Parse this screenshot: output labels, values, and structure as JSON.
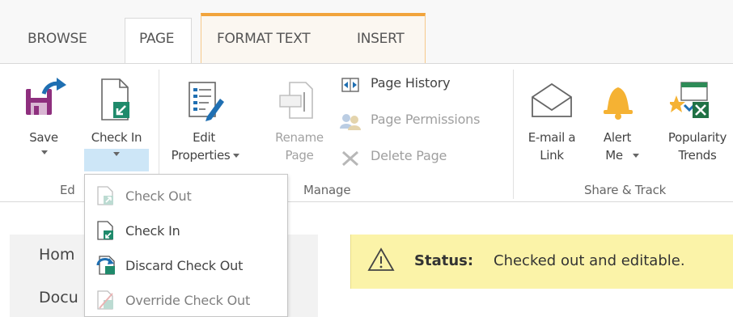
{
  "tabs": [
    {
      "label": "BROWSE"
    },
    {
      "label": "PAGE",
      "selected": true
    },
    {
      "label": "FORMAT TEXT"
    },
    {
      "label": "INSERT"
    }
  ],
  "ribbon": {
    "edit_group": {
      "save": "Save",
      "check_in": "Check In",
      "group_label": "Ed"
    },
    "manage_group": {
      "edit_properties_line1": "Edit",
      "edit_properties_line2": "Properties",
      "rename_line1": "Rename",
      "rename_line2": "Page",
      "page_history": "Page History",
      "page_permissions": "Page Permissions",
      "delete_page": "Delete Page",
      "group_label": "Manage"
    },
    "share_group": {
      "email_line1": "E-mail a",
      "email_line2": "Link",
      "alert_line1": "Alert",
      "alert_line2": "Me",
      "popularity_line1": "Popularity",
      "popularity_line2": "Trends",
      "group_label": "Share & Track"
    }
  },
  "dropdown": {
    "items": [
      {
        "label": "Check Out",
        "enabled": false
      },
      {
        "label": "Check In",
        "enabled": true
      },
      {
        "label": "Discard Check Out",
        "enabled": true
      },
      {
        "label": "Override Check Out",
        "enabled": false
      }
    ]
  },
  "nav": {
    "item1": "Hom",
    "item2": "Docu"
  },
  "status": {
    "label": "Status:",
    "message": "Checked out and editable."
  },
  "colors": {
    "context_tab_accent": "#f1a43c",
    "selection_highlight": "#cde6f7",
    "status_bar": "#fbf3a8",
    "save_icon": "#8e2f7e",
    "arrow_icon": "#1f6fb2",
    "alert_bell": "#f5b233",
    "excel_green": "#207245"
  }
}
